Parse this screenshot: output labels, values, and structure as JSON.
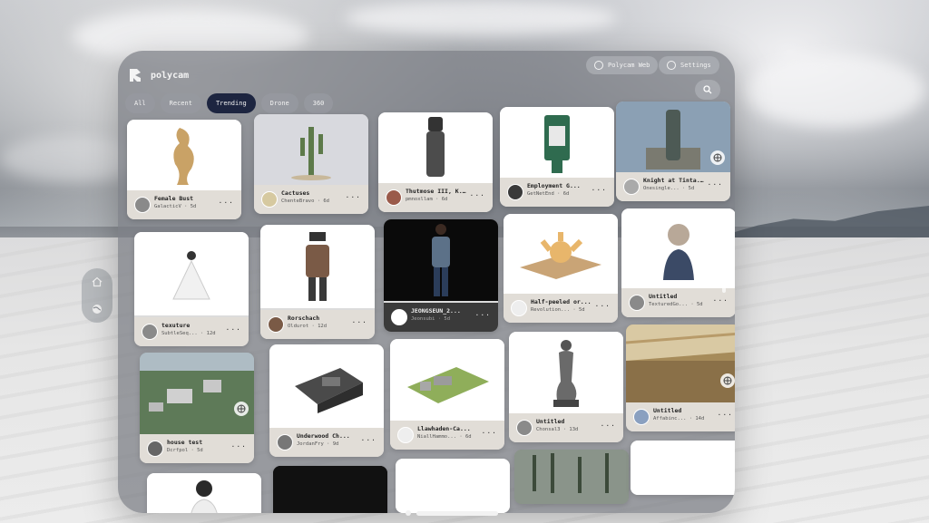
{
  "app": {
    "name": "polycam",
    "header_buttons": [
      {
        "label": "Polycam Web",
        "icon": "globe-icon"
      },
      {
        "label": "Settings",
        "icon": "gear-icon"
      }
    ],
    "search_icon": "search-icon"
  },
  "tabs": [
    {
      "label": "All",
      "active": false
    },
    {
      "label": "Recent",
      "active": false
    },
    {
      "label": "Trending",
      "active": true
    },
    {
      "label": "Drone",
      "active": false
    },
    {
      "label": "360",
      "active": false
    }
  ],
  "side_controls": [
    {
      "icon": "home-icon"
    },
    {
      "icon": "globe-icon"
    }
  ],
  "cards": [
    {
      "title": "Female Bust",
      "sub": "GalacticV · 5d",
      "dots": "···",
      "scene": "bust"
    },
    {
      "title": "Cactuses",
      "sub": "ChenteBravo · 6d",
      "dots": "···",
      "scene": "cactus"
    },
    {
      "title": "Thutmose III, K...",
      "sub": "pmnoxllam · 6d",
      "dots": "···",
      "scene": "statue"
    },
    {
      "title": "Employment G...",
      "sub": "GetNetEnd · 6d",
      "dots": "···",
      "scene": "kiosk"
    },
    {
      "title": "Knight at Tinta...",
      "sub": "Onesingle... · 5d",
      "dots": "···",
      "scene": "knight",
      "badge": true
    },
    {
      "title": "texuture",
      "sub": "SubtleSeq... · 12d",
      "dots": "···",
      "scene": "dress"
    },
    {
      "title": "Rorschach",
      "sub": "Oldurot · 12d",
      "dots": "···",
      "scene": "figure"
    },
    {
      "title": "JEONGSEUN_2...",
      "sub": "Jeonsubi · 5d",
      "dots": "···",
      "scene": "man",
      "dark": true
    },
    {
      "title": "Half-peeled or...",
      "sub": "Revolution... · 5d",
      "dots": "···",
      "scene": "orange"
    },
    {
      "title": "Untitled",
      "sub": "TexturedGo... · 5d",
      "dots": "···",
      "scene": "woman"
    },
    {
      "title": "house test",
      "sub": "Dcrfpol · 5d",
      "dots": "···",
      "scene": "town",
      "badge": true
    },
    {
      "title": "Underwood Ch...",
      "sub": "JordanFry · 9d",
      "dots": "···",
      "scene": "typewriter"
    },
    {
      "title": "Llawhaden-Ca...",
      "sub": "NiallHammo... · 6d",
      "dots": "···",
      "scene": "castle"
    },
    {
      "title": "Untitled",
      "sub": "Chonsal3 · 13d",
      "dots": "···",
      "scene": "mermaid"
    },
    {
      "title": "Untitled",
      "sub": "Affabinc... · 14d",
      "dots": "···",
      "scene": "interior",
      "badge": true
    }
  ],
  "colors": {
    "active_tab": "#1d2540",
    "panel": "#787c82"
  }
}
